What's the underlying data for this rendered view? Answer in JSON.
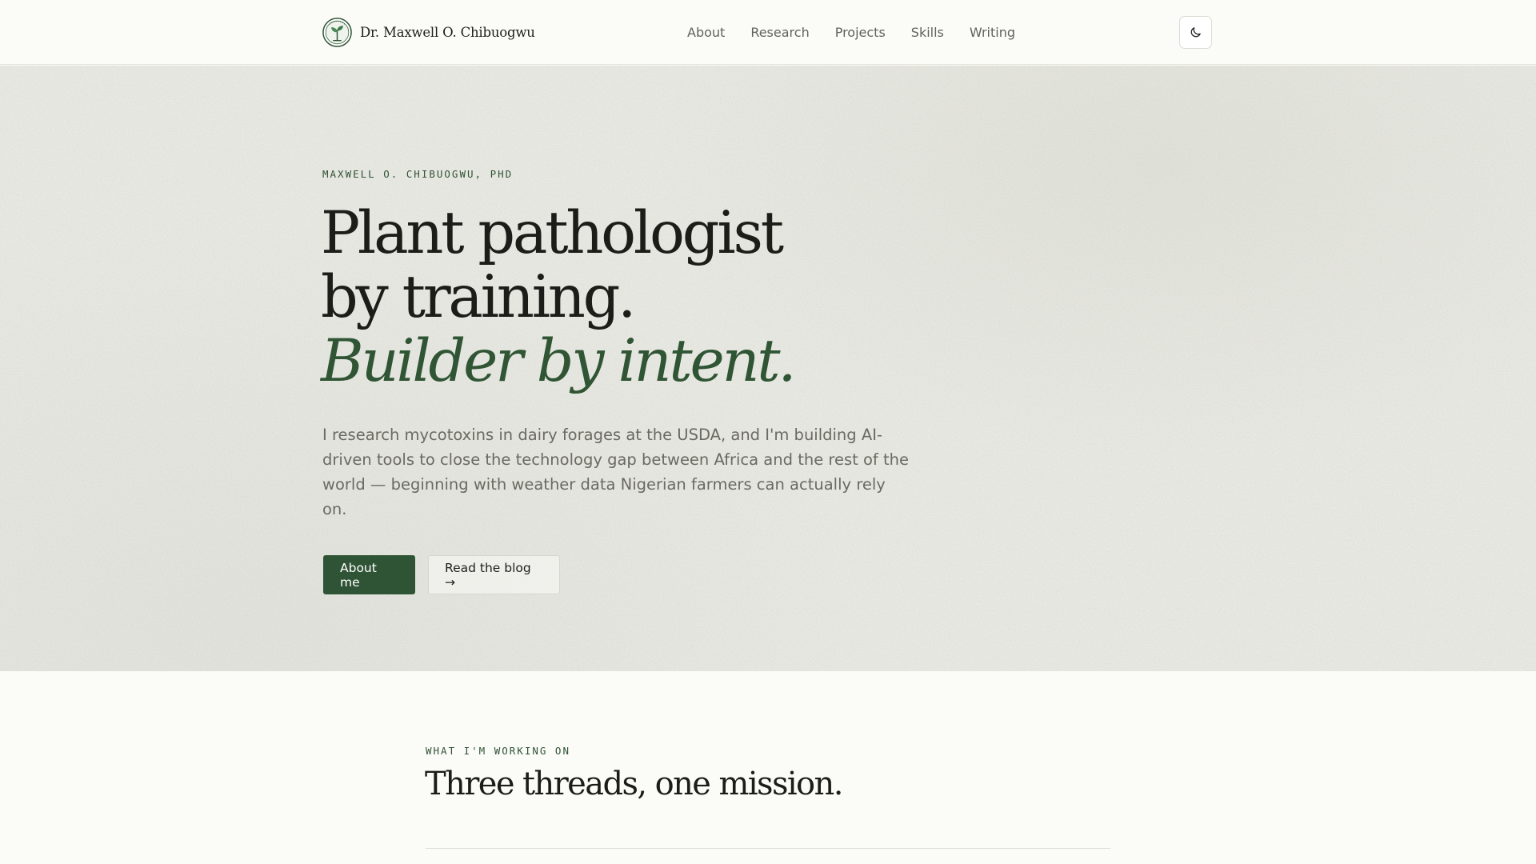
{
  "header": {
    "brand_name": "Dr. Maxwell O. Chibuogwu",
    "logo_icon": "seedling-seal-icon",
    "nav": [
      {
        "label": "About"
      },
      {
        "label": "Research"
      },
      {
        "label": "Projects"
      },
      {
        "label": "Skills"
      },
      {
        "label": "Writing"
      }
    ],
    "theme_toggle_icon": "moon-icon"
  },
  "hero": {
    "eyebrow": "MAXWELL O. CHIBUOGWU, PHD",
    "title_line1": "Plant pathologist",
    "title_line2": "by training.",
    "title_accent": "Builder by intent.",
    "lede": "I research mycotoxins in dairy forages at the USDA, and I'm building AI-driven tools to close the technology gap between Africa and the rest of the world — beginning with weather data Nigerian farmers can actually rely on.",
    "primary_button": "About me",
    "secondary_button": "Read the blog →"
  },
  "working": {
    "eyebrow": "WHAT I'M WORKING ON",
    "title": "Three threads, one mission."
  },
  "colors": {
    "accent_green": "#2f5435",
    "background": "#fbfbf7",
    "hero_background": "#ecece6",
    "text": "#1c1c19",
    "muted_text": "#6a6a63"
  }
}
